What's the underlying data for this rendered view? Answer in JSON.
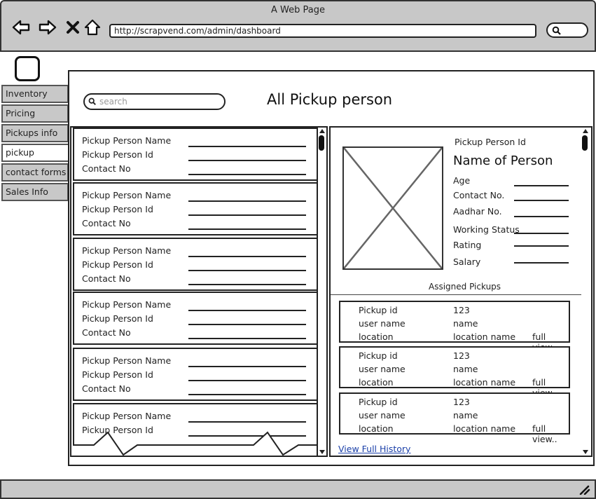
{
  "browser": {
    "title": "A Web Page",
    "url": "http://scrapvend.com/admin/dashboard"
  },
  "nav": {
    "items": [
      {
        "label": "Inventory"
      },
      {
        "label": "Pricing"
      },
      {
        "label": "Pickups info"
      },
      {
        "label": "pickup persons"
      },
      {
        "label": "contact forms"
      },
      {
        "label": "Sales Info"
      }
    ],
    "active": "pickup persons"
  },
  "page": {
    "title": "All Pickup person",
    "search_placeholder": "search"
  },
  "list": {
    "cards": [
      {
        "name_label": "Pickup Person Name",
        "id_label": "Pickup Person Id",
        "contact_label": "Contact No"
      },
      {
        "name_label": "Pickup Person Name",
        "id_label": "Pickup Person Id",
        "contact_label": "Contact No"
      },
      {
        "name_label": "Pickup Person Name",
        "id_label": "Pickup Person Id",
        "contact_label": "Contact No"
      },
      {
        "name_label": "Pickup Person Name",
        "id_label": "Pickup Person Id",
        "contact_label": "Contact No"
      },
      {
        "name_label": "Pickup Person Name",
        "id_label": "Pickup Person Id",
        "contact_label": "Contact No"
      },
      {
        "name_label": "Pickup Person Name",
        "id_label": "Pickup Person Id"
      }
    ]
  },
  "detail": {
    "id_label": "Pickup Person Id",
    "name": "Name of Person",
    "fields": [
      {
        "label": "Age"
      },
      {
        "label": "Contact No."
      },
      {
        "label": "Aadhar No."
      },
      {
        "label": "Working Status"
      },
      {
        "label": "Rating"
      },
      {
        "label": "Salary"
      }
    ],
    "assigned_title": "Assigned Pickups",
    "pickups": [
      {
        "id_label": "Pickup id",
        "id_value": "123",
        "user_label": "user name",
        "user_value": "name",
        "loc_label": "location",
        "loc_value": "location name",
        "link": "full view.."
      },
      {
        "id_label": "Pickup id",
        "id_value": "123",
        "user_label": "user name",
        "user_value": "name",
        "loc_label": "location",
        "loc_value": "location name",
        "link": "full view.."
      },
      {
        "id_label": "Pickup id",
        "id_value": "123",
        "user_label": "user name",
        "user_value": "name",
        "loc_label": "location",
        "loc_value": "location name",
        "link": "full view.."
      }
    ],
    "history_link": "View Full History"
  },
  "colors": {
    "chrome": "#c8c8c8",
    "link": "#1a3fa8",
    "border": "#222222"
  }
}
